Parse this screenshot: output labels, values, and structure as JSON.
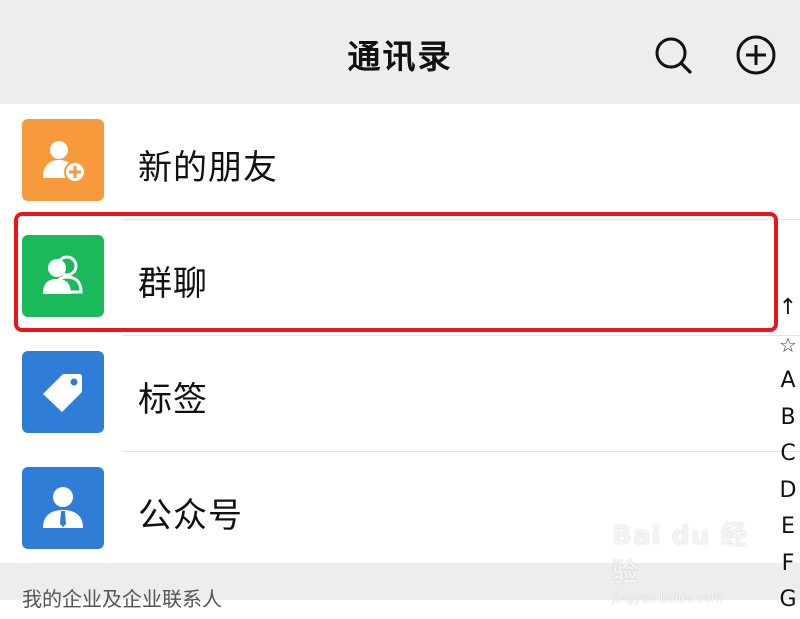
{
  "header": {
    "title": "通讯录",
    "search_icon": "search-icon",
    "add_icon": "plus-circle-icon"
  },
  "list": {
    "items": [
      {
        "label": "新的朋友",
        "icon": "add-friend-icon",
        "color": "#f69a3b"
      },
      {
        "label": "群聊",
        "icon": "group-chat-icon",
        "color": "#1ab95a"
      },
      {
        "label": "标签",
        "icon": "tag-icon",
        "color": "#2f7dd6"
      },
      {
        "label": "公众号",
        "icon": "official-account-icon",
        "color": "#2f7dd6"
      }
    ]
  },
  "section": {
    "label": "我的企业及企业联系人"
  },
  "index_bar": {
    "items": [
      "↑",
      "☆",
      "A",
      "B",
      "C",
      "D",
      "E",
      "F",
      "G"
    ]
  },
  "highlight": {
    "color": "#e8161b"
  },
  "watermark": {
    "main": "Bai du 经验",
    "sub": "jingyan.baidu.com"
  }
}
